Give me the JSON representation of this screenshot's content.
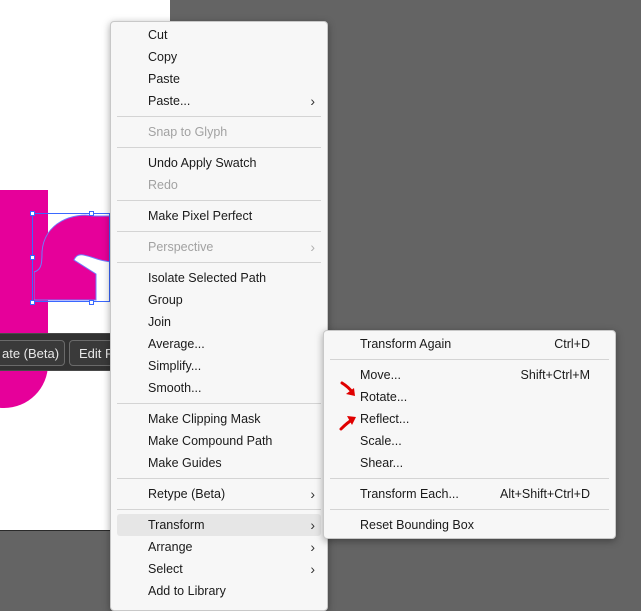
{
  "colors": {
    "magenta": "#e6009a",
    "selection": "#3a68ff",
    "annotation_red": "#e00000"
  },
  "taskbar": {
    "rotate_label": "ate (Beta)",
    "edit_label": "Edit P"
  },
  "context_menu": {
    "items": [
      {
        "label": "Cut"
      },
      {
        "label": "Copy"
      },
      {
        "label": "Paste"
      },
      {
        "label": "Paste..."
      },
      {
        "label": "Snap to Glyph"
      },
      {
        "label": "Undo Apply Swatch"
      },
      {
        "label": "Redo"
      },
      {
        "label": "Make Pixel Perfect"
      },
      {
        "label": "Perspective"
      },
      {
        "label": "Isolate Selected Path"
      },
      {
        "label": "Group"
      },
      {
        "label": "Join"
      },
      {
        "label": "Average..."
      },
      {
        "label": "Simplify..."
      },
      {
        "label": "Smooth..."
      },
      {
        "label": "Make Clipping Mask"
      },
      {
        "label": "Make Compound Path"
      },
      {
        "label": "Make Guides"
      },
      {
        "label": "Retype (Beta)"
      },
      {
        "label": "Transform"
      },
      {
        "label": "Arrange"
      },
      {
        "label": "Select"
      },
      {
        "label": "Add to Library"
      }
    ],
    "submenu_arrow": "›"
  },
  "transform_submenu": {
    "items": [
      {
        "label": "Transform Again",
        "shortcut": "Ctrl+D"
      },
      {
        "label": "Move...",
        "shortcut": "Shift+Ctrl+M"
      },
      {
        "label": "Rotate..."
      },
      {
        "label": "Reflect..."
      },
      {
        "label": "Scale..."
      },
      {
        "label": "Shear..."
      },
      {
        "label": "Transform Each...",
        "shortcut": "Alt+Shift+Ctrl+D"
      },
      {
        "label": "Reset Bounding Box"
      }
    ]
  },
  "annotations": [
    {
      "icon": "red-arrow-icon",
      "points_to": "Rotate..."
    },
    {
      "icon": "red-arrow-icon",
      "points_to": "Reflect..."
    }
  ]
}
